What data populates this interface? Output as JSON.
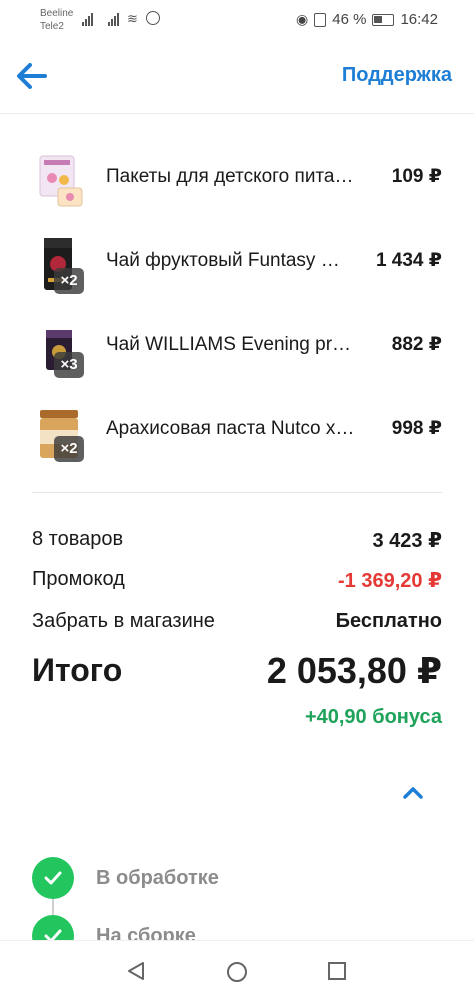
{
  "status_bar": {
    "carrier1": "Beeline",
    "carrier2": "Tele2",
    "battery": "46 %",
    "time": "16:42"
  },
  "header": {
    "back_icon": "arrow-left-icon",
    "support_label": "Поддержка",
    "accent_color": "#1e7ed6"
  },
  "items": [
    {
      "name": "Пакеты для детского пита…",
      "price": "109 ₽",
      "qty": ""
    },
    {
      "name": "Чай фруктовый Funtasy …",
      "price": "1 434 ₽",
      "qty": "×2"
    },
    {
      "name": "Чай WILLIAMS Evening pr…",
      "price": "882 ₽",
      "qty": "×3"
    },
    {
      "name": "Арахисовая паста Nutco х…",
      "price": "998 ₽",
      "qty": "×2"
    }
  ],
  "summary": {
    "count_label": "8 товаров",
    "count_value": "3 423 ₽",
    "promo_label": "Промокод",
    "promo_value": "-1 369,20 ₽",
    "pickup_label": "Забрать в магазине",
    "pickup_value": "Бесплатно",
    "total_label": "Итого",
    "total_value": "2 053,80 ₽",
    "bonus": "+40,90 бонуса",
    "discount_color": "#e53935",
    "bonus_color": "#1fa35a"
  },
  "timeline": {
    "steps": [
      {
        "label": "В обработке"
      },
      {
        "label": "На сборке"
      }
    ],
    "check_color": "#22c55e"
  },
  "nav": {
    "back": "triangle-back-icon",
    "home": "circle-home-icon",
    "recents": "square-recents-icon"
  }
}
